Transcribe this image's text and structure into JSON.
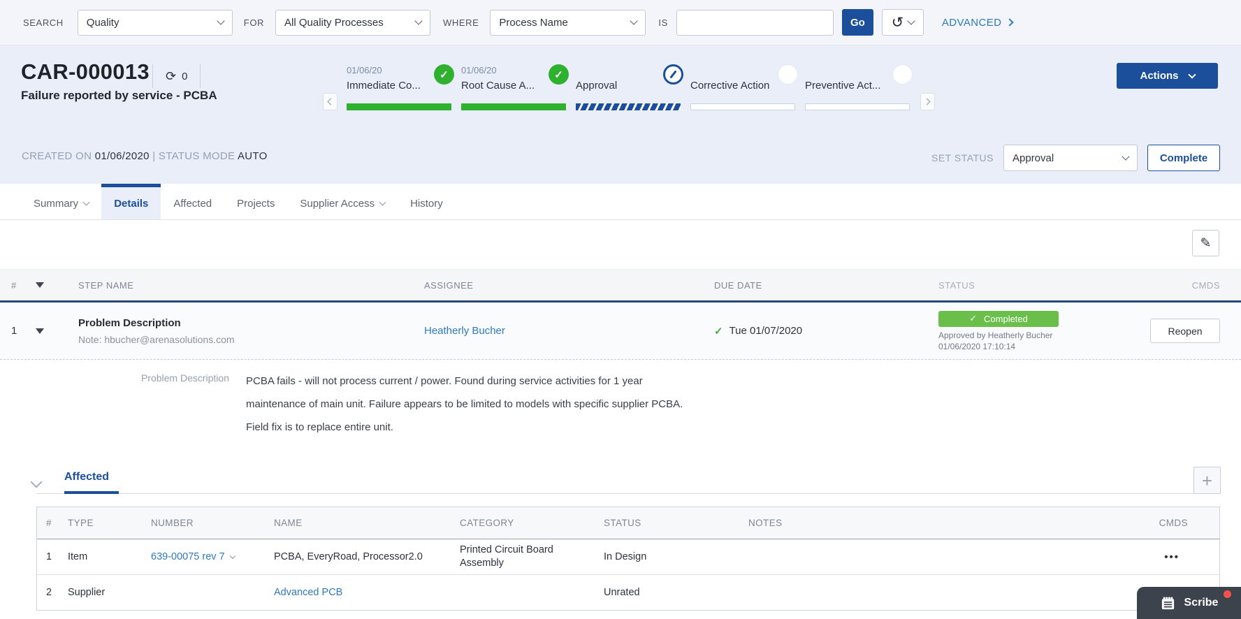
{
  "colors": {
    "brand_blue": "#1b4f9c",
    "link_blue": "#2e7ac2",
    "success_green": "#2fb12f",
    "badge_green": "#6abf4b"
  },
  "icons": {
    "check": "✓",
    "pencil": "✎",
    "plus": "+",
    "history": "↺",
    "revisions": "⟳",
    "more": "•••"
  },
  "search_bar": {
    "search_label": "SEARCH",
    "search_type": "Quality",
    "for_label": "FOR",
    "process_scope": "All Quality Processes",
    "where_label": "WHERE",
    "field": "Process Name",
    "is_label": "IS",
    "query": "",
    "go_label": "Go",
    "advanced_label": "ADVANCED"
  },
  "header": {
    "number": "CAR-000013",
    "revision_count": "0",
    "title": "Failure reported by service - PCBA",
    "actions_label": "Actions",
    "steps": [
      {
        "date": "01/06/20",
        "label": "Immediate Co...",
        "state": "complete"
      },
      {
        "date": "01/06/20",
        "label": "Root Cause A...",
        "state": "complete"
      },
      {
        "date": "",
        "label": "Approval",
        "state": "in-progress"
      },
      {
        "date": "",
        "label": "Corrective Action",
        "state": "pending"
      },
      {
        "date": "",
        "label": "Preventive Act...",
        "state": "pending"
      }
    ],
    "created_on_label": "CREATED ON",
    "created_on": "01/06/2020",
    "divider": "|",
    "status_mode_label": "STATUS MODE",
    "status_mode": "AUTO",
    "set_status_label": "SET STATUS",
    "set_status": "Approval",
    "complete_label": "Complete"
  },
  "tabs": [
    {
      "label": "Summary"
    },
    {
      "label": "Details"
    },
    {
      "label": "Affected"
    },
    {
      "label": "Projects"
    },
    {
      "label": "Supplier Access"
    },
    {
      "label": "History"
    }
  ],
  "steps_table": {
    "headers": {
      "num": "#",
      "step_name": "STEP NAME",
      "assignee": "ASSIGNEE",
      "due_date": "DUE DATE",
      "status": "STATUS",
      "cmds": "CMDS"
    },
    "row": {
      "num": "1",
      "name": "Problem Description",
      "note": "Note: hbucher@arenasolutions.com",
      "assignee": "Heatherly Bucher",
      "due_date": "Tue 01/07/2020",
      "status_badge": "Completed",
      "approved_by": "Approved by Heatherly Bucher",
      "approved_at": "01/06/2020 17:10:14",
      "reopen_label": "Reopen"
    },
    "detail": {
      "label": "Problem Description",
      "text": "PCBA fails - will not process current / power. Found during service activities for 1 year maintenance of main unit. Failure appears to be limited to models with specific supplier PCBA. Field fix is to replace entire unit."
    }
  },
  "affected": {
    "title": "Affected",
    "headers": {
      "num": "#",
      "type": "TYPE",
      "number": "NUMBER",
      "name": "NAME",
      "category": "CATEGORY",
      "status": "STATUS",
      "notes": "NOTES",
      "cmds": "CMDS"
    },
    "rows": [
      {
        "num": "1",
        "type": "Item",
        "number": "639-00075 rev 7",
        "name": "PCBA, EveryRoad, Processor2.0",
        "category": "Printed Circuit Board Assembly",
        "status": "In Design",
        "notes": ""
      },
      {
        "num": "2",
        "type": "Supplier",
        "number": "",
        "name": "Advanced PCB",
        "category": "",
        "status": "Unrated",
        "notes": ""
      }
    ]
  },
  "scribe": {
    "label": "Scribe"
  }
}
